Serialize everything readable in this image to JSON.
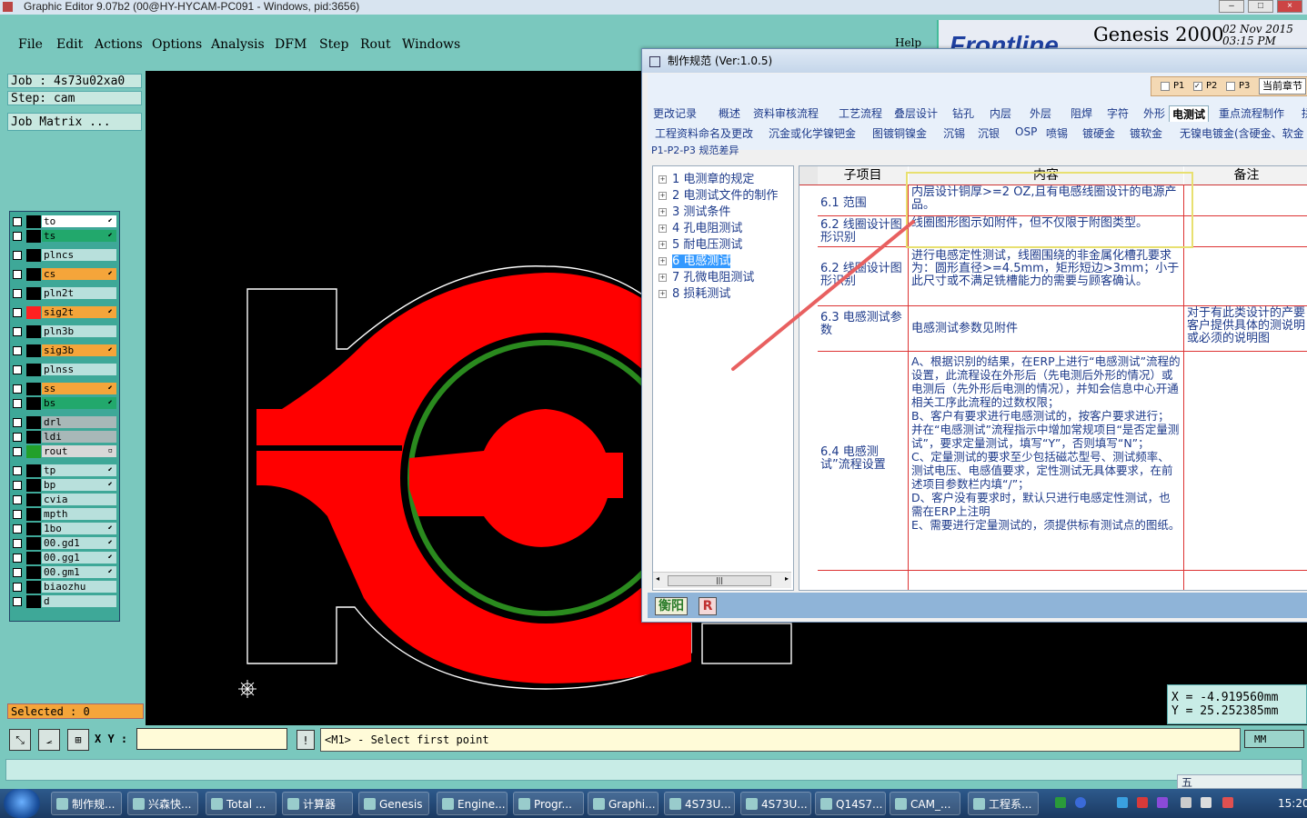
{
  "titlebar": {
    "title": "Graphic Editor 9.07b2 (00@HY-HYCAM-PC091 - Windows, pid:3656)"
  },
  "menu": [
    "File",
    "Edit",
    "Actions",
    "Options",
    "Analysis",
    "DFM",
    "Step",
    "Rout",
    "Windows"
  ],
  "help_label": "Help",
  "brand": {
    "logo": "Frontline",
    "product": "Genesis 2000",
    "date": "02 Nov 2015",
    "time": "03:15 PM"
  },
  "job": {
    "job_label": "Job : 4s73u02xa0",
    "step_label": "Step: cam",
    "matrix_label": "Job Matrix ..."
  },
  "layers": [
    {
      "name": "to",
      "bg": "#ffffff",
      "color": "#000000",
      "arrow": "⬋"
    },
    {
      "name": "ts",
      "bg": "#22a86c",
      "color": "#000000",
      "arrow": "⬋"
    },
    {
      "name": "plncs",
      "bg": "#b8e0dc",
      "color": "#000000",
      "arrow": ""
    },
    {
      "name": "cs",
      "bg": "#f5a53a",
      "color": "#000000",
      "arrow": "⬋"
    },
    {
      "name": "pln2t",
      "bg": "#b8e0dc",
      "color": "#000000",
      "arrow": ""
    },
    {
      "name": "sig2t",
      "bg": "#f5a53a",
      "color": "#ff2020",
      "arrow": "⬋"
    },
    {
      "name": "pln3b",
      "bg": "#b8e0dc",
      "color": "#000000",
      "arrow": ""
    },
    {
      "name": "sig3b",
      "bg": "#f5a53a",
      "color": "#000000",
      "arrow": "⬋"
    },
    {
      "name": "plnss",
      "bg": "#b8e0dc",
      "color": "#000000",
      "arrow": ""
    },
    {
      "name": "ss",
      "bg": "#f5a53a",
      "color": "#000000",
      "arrow": "⬋"
    },
    {
      "name": "bs",
      "bg": "#22a86c",
      "color": "#000000",
      "arrow": "⬋"
    },
    {
      "name": "drl",
      "bg": "#a8b8b8",
      "color": "#000000",
      "arrow": ""
    },
    {
      "name": "ldi",
      "bg": "#a8b8b8",
      "color": "#000000",
      "arrow": ""
    },
    {
      "name": "rout",
      "bg": "#d8d8d8",
      "color": "#22a02a",
      "arrow": "▫"
    },
    {
      "name": "tp",
      "bg": "#b8e0dc",
      "color": "#000000",
      "arrow": "⬋"
    },
    {
      "name": "bp",
      "bg": "#b8e0dc",
      "color": "#000000",
      "arrow": "⬋"
    },
    {
      "name": "cvia",
      "bg": "#b8e0dc",
      "color": "#000000",
      "arrow": ""
    },
    {
      "name": "mpth",
      "bg": "#b8e0dc",
      "color": "#000000",
      "arrow": ""
    },
    {
      "name": "1bo",
      "bg": "#b8e0dc",
      "color": "#000000",
      "arrow": "⬋"
    },
    {
      "name": "00.gd1",
      "bg": "#b8e0dc",
      "color": "#000000",
      "arrow": "⬋"
    },
    {
      "name": "00.gg1",
      "bg": "#b8e0dc",
      "color": "#000000",
      "arrow": "⬋"
    },
    {
      "name": "00.gm1",
      "bg": "#b8e0dc",
      "color": "#000000",
      "arrow": "⬋"
    },
    {
      "name": "biaozhu",
      "bg": "#b8e0dc",
      "color": "#000000",
      "arrow": ""
    },
    {
      "name": "d",
      "bg": "#b8e0dc",
      "color": "#000000",
      "arrow": ""
    }
  ],
  "selected_label": "Selected : 0",
  "xy_label": "X Y :",
  "xy_value": "",
  "prompt": "<M1> - Select first point",
  "unit": "MM",
  "coords": {
    "x": "X  =  -4.919560mm",
    "y": "Y  =  25.252385mm"
  },
  "dialog": {
    "title": "制作规范 (Ver:1.0.5)",
    "p_options": {
      "p1": "P1",
      "p2": "P2",
      "p3": "P3",
      "current": "当前章节"
    },
    "tabs_row1": [
      "更改记录",
      "概述",
      "资料审核流程",
      "工艺流程",
      "叠层设计",
      "钻孔",
      "内层",
      "外层",
      "阻焊",
      "字符",
      "外形",
      "电测试",
      "重点流程制作",
      "拼"
    ],
    "tabs_row2": [
      "工程资料命名及更改",
      "沉金或化学镍钯金",
      "图镀铜镍金",
      "沉锡",
      "沉银",
      "OSP",
      "喷锡",
      "镀硬金",
      "镀软金",
      "无镍电镀金(含硬金、软金"
    ],
    "subtab": "P1-P2-P3 规范差异",
    "tree": [
      {
        "num": "1",
        "label": "电测章的规定"
      },
      {
        "num": "2",
        "label": "电测试文件的制作"
      },
      {
        "num": "3",
        "label": "测试条件"
      },
      {
        "num": "4",
        "label": "孔电阻测试"
      },
      {
        "num": "5",
        "label": "耐电压测试"
      },
      {
        "num": "6",
        "label": "电感测试"
      },
      {
        "num": "7",
        "label": "孔微电阻测试"
      },
      {
        "num": "8",
        "label": "损耗测试"
      }
    ],
    "grid_headers": [
      "子项目",
      "内容",
      "备注"
    ],
    "grid_rows": [
      {
        "item": "6.1 范围",
        "content": "内层设计铜厚>=2 OZ,且有电感线圈设计的电源产品。",
        "note": ""
      },
      {
        "item": "6.2 线圈设计图形识别",
        "content": "线圈图形图示如附件，但不仅限于附图类型。",
        "note": ""
      },
      {
        "item": "6.2 线圈设计图形识别",
        "content": "进行电感定性测试，线圈围绕的非金属化槽孔要求为：圆形直径>=4.5mm，矩形短边>3mm；小于此尺寸或不满足铣槽能力的需要与顾客确认。",
        "note": ""
      },
      {
        "item": "6.3 电感测试参数",
        "content": "电感测试参数见附件",
        "note": "对于有此类设计的产要客户提供具体的测说明或必须的说明图"
      },
      {
        "item": "6.4 电感测试”流程设置",
        "content": "A、根据识别的结果，在ERP上进行“电感测试”流程的设置，此流程设在外形后（先电测后外形的情况）或电测后（先外形后电测的情况），并知会信息中心开通相关工序此流程的过数权限；\nB、客户有要求进行电感测试的，按客户要求进行；并在“电感测试”流程指示中增加常规项目“是否定量测试”，要求定量测试，填写“Y”，否则填写“N”；\nC、定量测试的要求至少包括磁芯型号、测试频率、测试电压、电感值要求，定性测试无具体要求，在前述项目参数栏内填“/”；\nD、客户没有要求时，默认只进行电感定性测试，也需在ERP上注明\nE、需要进行定量测试的，须提供标有测试点的图纸。",
        "note": ""
      }
    ],
    "bottom": {
      "hengyang": "衡阳",
      "r": "R"
    }
  },
  "taskbar": [
    {
      "label": "制作规...",
      "icon": "app-icon"
    },
    {
      "label": "兴森快...",
      "icon": "app-icon"
    },
    {
      "label": "Total ...",
      "icon": "app-icon"
    },
    {
      "label": "计算器",
      "icon": "calculator-icon"
    },
    {
      "label": "Genesis",
      "icon": "genesis-icon"
    },
    {
      "label": "Engine...",
      "icon": "app-icon"
    },
    {
      "label": "Progr...",
      "icon": "app-icon"
    },
    {
      "label": "Graphi...",
      "icon": "app-icon"
    },
    {
      "label": "4S73U...",
      "icon": "excel-icon"
    },
    {
      "label": "4S73U...",
      "icon": "excel-icon"
    },
    {
      "label": "Q14S7...",
      "icon": "excel-icon"
    },
    {
      "label": "CAM_...",
      "icon": "app-icon"
    },
    {
      "label": "工程系...",
      "icon": "app-icon"
    }
  ],
  "ime_label": "五",
  "clock": "15:20",
  "colors": {
    "board_copper": "#ff0000",
    "trace_green": "#2a8a1e",
    "panel_teal": "#7ac8be",
    "highlight_orange": "#f5a53a"
  }
}
